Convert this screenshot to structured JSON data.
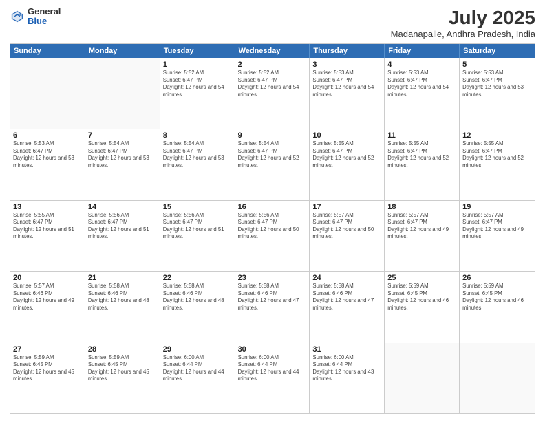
{
  "header": {
    "logo_general": "General",
    "logo_blue": "Blue",
    "title": "July 2025",
    "subtitle": "Madanapalle, Andhra Pradesh, India"
  },
  "days_of_week": [
    "Sunday",
    "Monday",
    "Tuesday",
    "Wednesday",
    "Thursday",
    "Friday",
    "Saturday"
  ],
  "weeks": [
    [
      {
        "day": "",
        "sunrise": "",
        "sunset": "",
        "daylight": ""
      },
      {
        "day": "",
        "sunrise": "",
        "sunset": "",
        "daylight": ""
      },
      {
        "day": "1",
        "sunrise": "Sunrise: 5:52 AM",
        "sunset": "Sunset: 6:47 PM",
        "daylight": "Daylight: 12 hours and 54 minutes."
      },
      {
        "day": "2",
        "sunrise": "Sunrise: 5:52 AM",
        "sunset": "Sunset: 6:47 PM",
        "daylight": "Daylight: 12 hours and 54 minutes."
      },
      {
        "day": "3",
        "sunrise": "Sunrise: 5:53 AM",
        "sunset": "Sunset: 6:47 PM",
        "daylight": "Daylight: 12 hours and 54 minutes."
      },
      {
        "day": "4",
        "sunrise": "Sunrise: 5:53 AM",
        "sunset": "Sunset: 6:47 PM",
        "daylight": "Daylight: 12 hours and 54 minutes."
      },
      {
        "day": "5",
        "sunrise": "Sunrise: 5:53 AM",
        "sunset": "Sunset: 6:47 PM",
        "daylight": "Daylight: 12 hours and 53 minutes."
      }
    ],
    [
      {
        "day": "6",
        "sunrise": "Sunrise: 5:53 AM",
        "sunset": "Sunset: 6:47 PM",
        "daylight": "Daylight: 12 hours and 53 minutes."
      },
      {
        "day": "7",
        "sunrise": "Sunrise: 5:54 AM",
        "sunset": "Sunset: 6:47 PM",
        "daylight": "Daylight: 12 hours and 53 minutes."
      },
      {
        "day": "8",
        "sunrise": "Sunrise: 5:54 AM",
        "sunset": "Sunset: 6:47 PM",
        "daylight": "Daylight: 12 hours and 53 minutes."
      },
      {
        "day": "9",
        "sunrise": "Sunrise: 5:54 AM",
        "sunset": "Sunset: 6:47 PM",
        "daylight": "Daylight: 12 hours and 52 minutes."
      },
      {
        "day": "10",
        "sunrise": "Sunrise: 5:55 AM",
        "sunset": "Sunset: 6:47 PM",
        "daylight": "Daylight: 12 hours and 52 minutes."
      },
      {
        "day": "11",
        "sunrise": "Sunrise: 5:55 AM",
        "sunset": "Sunset: 6:47 PM",
        "daylight": "Daylight: 12 hours and 52 minutes."
      },
      {
        "day": "12",
        "sunrise": "Sunrise: 5:55 AM",
        "sunset": "Sunset: 6:47 PM",
        "daylight": "Daylight: 12 hours and 52 minutes."
      }
    ],
    [
      {
        "day": "13",
        "sunrise": "Sunrise: 5:55 AM",
        "sunset": "Sunset: 6:47 PM",
        "daylight": "Daylight: 12 hours and 51 minutes."
      },
      {
        "day": "14",
        "sunrise": "Sunrise: 5:56 AM",
        "sunset": "Sunset: 6:47 PM",
        "daylight": "Daylight: 12 hours and 51 minutes."
      },
      {
        "day": "15",
        "sunrise": "Sunrise: 5:56 AM",
        "sunset": "Sunset: 6:47 PM",
        "daylight": "Daylight: 12 hours and 51 minutes."
      },
      {
        "day": "16",
        "sunrise": "Sunrise: 5:56 AM",
        "sunset": "Sunset: 6:47 PM",
        "daylight": "Daylight: 12 hours and 50 minutes."
      },
      {
        "day": "17",
        "sunrise": "Sunrise: 5:57 AM",
        "sunset": "Sunset: 6:47 PM",
        "daylight": "Daylight: 12 hours and 50 minutes."
      },
      {
        "day": "18",
        "sunrise": "Sunrise: 5:57 AM",
        "sunset": "Sunset: 6:47 PM",
        "daylight": "Daylight: 12 hours and 49 minutes."
      },
      {
        "day": "19",
        "sunrise": "Sunrise: 5:57 AM",
        "sunset": "Sunset: 6:47 PM",
        "daylight": "Daylight: 12 hours and 49 minutes."
      }
    ],
    [
      {
        "day": "20",
        "sunrise": "Sunrise: 5:57 AM",
        "sunset": "Sunset: 6:46 PM",
        "daylight": "Daylight: 12 hours and 49 minutes."
      },
      {
        "day": "21",
        "sunrise": "Sunrise: 5:58 AM",
        "sunset": "Sunset: 6:46 PM",
        "daylight": "Daylight: 12 hours and 48 minutes."
      },
      {
        "day": "22",
        "sunrise": "Sunrise: 5:58 AM",
        "sunset": "Sunset: 6:46 PM",
        "daylight": "Daylight: 12 hours and 48 minutes."
      },
      {
        "day": "23",
        "sunrise": "Sunrise: 5:58 AM",
        "sunset": "Sunset: 6:46 PM",
        "daylight": "Daylight: 12 hours and 47 minutes."
      },
      {
        "day": "24",
        "sunrise": "Sunrise: 5:58 AM",
        "sunset": "Sunset: 6:46 PM",
        "daylight": "Daylight: 12 hours and 47 minutes."
      },
      {
        "day": "25",
        "sunrise": "Sunrise: 5:59 AM",
        "sunset": "Sunset: 6:45 PM",
        "daylight": "Daylight: 12 hours and 46 minutes."
      },
      {
        "day": "26",
        "sunrise": "Sunrise: 5:59 AM",
        "sunset": "Sunset: 6:45 PM",
        "daylight": "Daylight: 12 hours and 46 minutes."
      }
    ],
    [
      {
        "day": "27",
        "sunrise": "Sunrise: 5:59 AM",
        "sunset": "Sunset: 6:45 PM",
        "daylight": "Daylight: 12 hours and 45 minutes."
      },
      {
        "day": "28",
        "sunrise": "Sunrise: 5:59 AM",
        "sunset": "Sunset: 6:45 PM",
        "daylight": "Daylight: 12 hours and 45 minutes."
      },
      {
        "day": "29",
        "sunrise": "Sunrise: 6:00 AM",
        "sunset": "Sunset: 6:44 PM",
        "daylight": "Daylight: 12 hours and 44 minutes."
      },
      {
        "day": "30",
        "sunrise": "Sunrise: 6:00 AM",
        "sunset": "Sunset: 6:44 PM",
        "daylight": "Daylight: 12 hours and 44 minutes."
      },
      {
        "day": "31",
        "sunrise": "Sunrise: 6:00 AM",
        "sunset": "Sunset: 6:44 PM",
        "daylight": "Daylight: 12 hours and 43 minutes."
      },
      {
        "day": "",
        "sunrise": "",
        "sunset": "",
        "daylight": ""
      },
      {
        "day": "",
        "sunrise": "",
        "sunset": "",
        "daylight": ""
      }
    ]
  ]
}
